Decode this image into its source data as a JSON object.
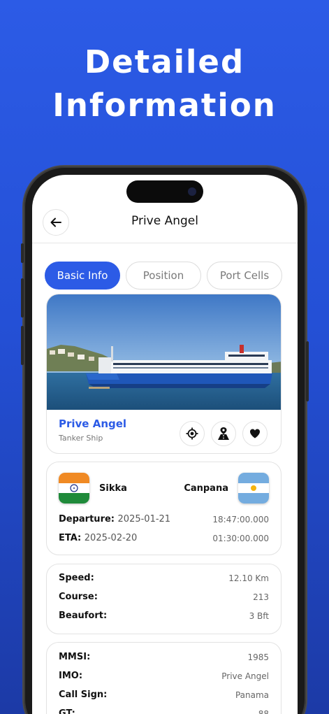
{
  "hero": {
    "line1": "Detailed",
    "line2": "Information"
  },
  "nav": {
    "title": "Prive Angel"
  },
  "tabs": [
    "Basic Info",
    "Position",
    "Port Cells"
  ],
  "ship": {
    "name": "Prive Angel",
    "type": "Tanker Ship"
  },
  "route": {
    "from_port": "Sikka",
    "to_port": "Canpana",
    "departure_label": "Departure:",
    "departure_date": "2025-01-21",
    "departure_time": "18:47:00.000",
    "eta_label": "ETA:",
    "eta_date": "2025-02-20",
    "eta_time": "01:30:00.000"
  },
  "stats": [
    {
      "label": "Speed:",
      "value": "12.10 Km"
    },
    {
      "label": "Course:",
      "value": "213"
    },
    {
      "label": "Beaufort:",
      "value": "3 Bft"
    }
  ],
  "ids": [
    {
      "label": "MMSI:",
      "value": "1985"
    },
    {
      "label": "IMO:",
      "value": "Prive Angel"
    },
    {
      "label": "Call Sign:",
      "value": "Panama"
    },
    {
      "label": "GT:",
      "value": "88"
    }
  ],
  "colors": {
    "accent": "#2c5be6",
    "background": "#2450d6"
  },
  "icons": [
    "back-arrow-icon",
    "locate-icon",
    "route-icon",
    "heart-icon"
  ]
}
